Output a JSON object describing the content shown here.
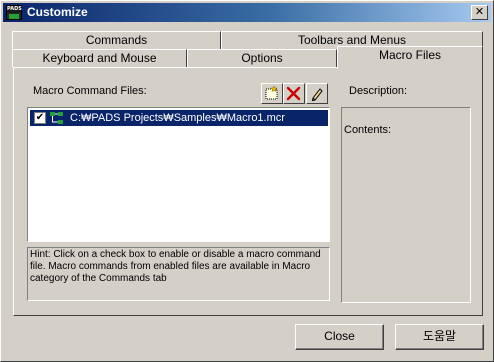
{
  "window": {
    "title": "Customize",
    "app_icon_text": "PADS",
    "close_glyph": "✕"
  },
  "tabs": {
    "row1": [
      "Commands",
      "Toolbars and Menus"
    ],
    "row2": [
      "Keyboard and Mouse",
      "Options",
      "Macro Files"
    ],
    "active": "Macro Files"
  },
  "macro_files": {
    "list_label": "Macro Command Files:",
    "toolbar": {
      "new_icon": "new-file-icon",
      "delete_icon": "delete-x-icon",
      "edit_icon": "pencil-edit-icon"
    },
    "items": [
      {
        "checked": true,
        "check_glyph": "✔",
        "icon": "macro-tree-icon",
        "path": "C:₩PADS Projects₩Samples₩Macro1.mcr",
        "selected": true
      }
    ],
    "hint": "Hint: Click on a check box to enable or disable a  macro command file. Macro commands from enabled files are available in Macro category of the Commands tab",
    "description_label": "Description:",
    "contents_label": "Contents:"
  },
  "buttons": {
    "close": "Close",
    "help": "도움말"
  },
  "colors": {
    "face": "#d4d0c8",
    "title_start": "#0a246a",
    "title_end": "#a6caf0",
    "selection": "#0a246a",
    "delete_red": "#cc0000"
  }
}
